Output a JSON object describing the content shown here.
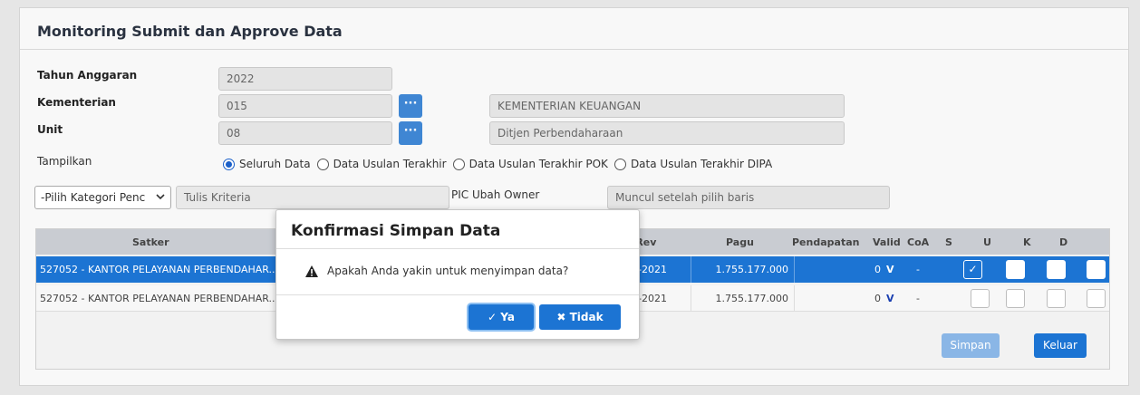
{
  "panel": {
    "title": "Monitoring Submit dan Approve Data"
  },
  "form": {
    "tahun_label": "Tahun Anggaran",
    "tahun_value": "2022",
    "kementerian_label": "Kementerian",
    "kementerian_code": "015",
    "kementerian_name": "KEMENTERIAN KEUANGAN",
    "unit_label": "Unit",
    "unit_code": "08",
    "unit_name": "Ditjen Perbendaharaan",
    "tampilkan_label": "Tampilkan",
    "dots": "···",
    "radio_options": [
      "Seluruh Data",
      "Data Usulan Terakhir",
      "Data Usulan Terakhir POK",
      "Data Usulan Terakhir DIPA"
    ],
    "radio_selected": "Seluruh Data"
  },
  "filter": {
    "category_select": "-Pilih Kategori Penc",
    "criteria_placeholder": "Tulis Kriteria",
    "pic_label": "PIC Ubah Owner",
    "pic_placeholder": "Muncul setelah pilih baris"
  },
  "table": {
    "headers": [
      "Satker",
      "l-Rev",
      "Pagu",
      "Pendapatan",
      "Valid",
      "CoA",
      "S",
      "U",
      "K",
      "D"
    ],
    "rows": [
      {
        "satker": "527052 - KANTOR PELAYANAN PERBENDAHAR...",
        "rev": "11-2021",
        "pagu": "1.755.177.000",
        "pendapatan": "0",
        "valid": "V",
        "coa": "-",
        "s_checked": true,
        "selected": true
      },
      {
        "satker": "527052 - KANTOR PELAYANAN PERBENDAHAR...",
        "rev": "11-2021",
        "pagu": "1.755.177.000",
        "pendapatan": "0",
        "valid": "V",
        "coa": "-",
        "s_checked": false,
        "selected": false
      }
    ],
    "check_mark": "✓"
  },
  "buttons": {
    "simpan": "Simpan",
    "keluar": "Keluar"
  },
  "modal": {
    "title": "Konfirmasi Simpan Data",
    "message": "Apakah Anda yakin untuk menyimpan data?",
    "ya_label": "✓  Ya",
    "tidak_label": "✖  Tidak"
  },
  "colors": {
    "primary": "#1c74d3",
    "header_bg": "#c9ccd2",
    "disabled_btn": "#8ab6e6"
  }
}
